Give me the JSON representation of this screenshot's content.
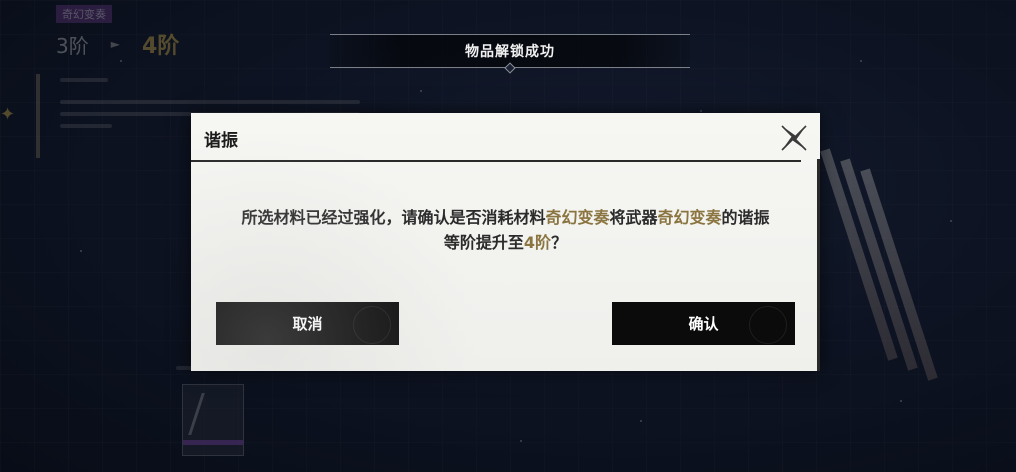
{
  "banner": {
    "text": "物品解锁成功"
  },
  "background_panel": {
    "tag": "奇幻变奏",
    "level_from": "3阶",
    "arrow": "►",
    "level_to": "4阶"
  },
  "dialog": {
    "title": "谐振",
    "close_icon": "close-x-icon",
    "message": {
      "part1": "所选材料已经过强化，请确认是否消耗材料",
      "material": "奇幻变奏",
      "part2": "将武器",
      "weapon": "奇幻变奏",
      "part3": "的谐振",
      "part4": "等阶提升至",
      "level": "4阶",
      "part5": "？"
    },
    "cancel_label": "取消",
    "confirm_label": "确认"
  },
  "colors": {
    "highlight": "#8a7440",
    "dialog_bg": "#f6f6f3",
    "button_bg": "#0b0b0b",
    "rarity_purple": "#8a4fb8",
    "gold": "#d9b64f"
  }
}
